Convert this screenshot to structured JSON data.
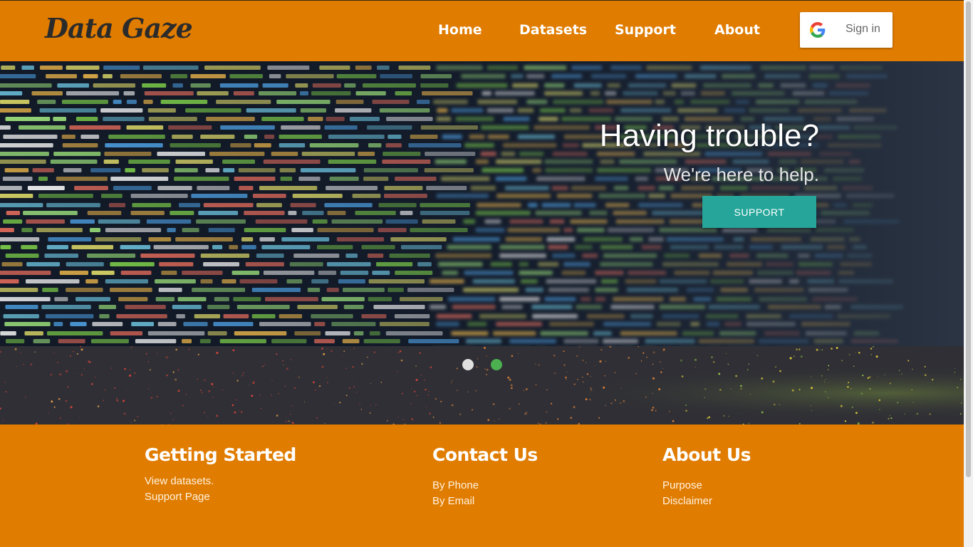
{
  "brand": {
    "logo_text": "Data Gaze"
  },
  "nav": [
    {
      "label": "Home"
    },
    {
      "label": "Datasets"
    },
    {
      "label": "Support"
    },
    {
      "label": "About"
    }
  ],
  "signin": {
    "label": "Sign in",
    "icon": "google-icon"
  },
  "hero": {
    "title": "Having trouble?",
    "subtitle": "We're here to help.",
    "button_label": "SUPPORT"
  },
  "carousel": {
    "slide_count": 2,
    "active_slide": 2
  },
  "footer": {
    "columns": [
      {
        "heading": "Getting Started",
        "links": [
          "View datasets.",
          "Support Page"
        ]
      },
      {
        "heading": "Contact Us",
        "links": [
          "By Phone",
          "By Email"
        ]
      },
      {
        "heading": "About Us",
        "links": [
          "Purpose",
          "Disclaimer"
        ]
      }
    ]
  },
  "colors": {
    "brand_orange": "#e07c00",
    "teal_button": "#26a69a",
    "active_dot": "#4caf50"
  }
}
